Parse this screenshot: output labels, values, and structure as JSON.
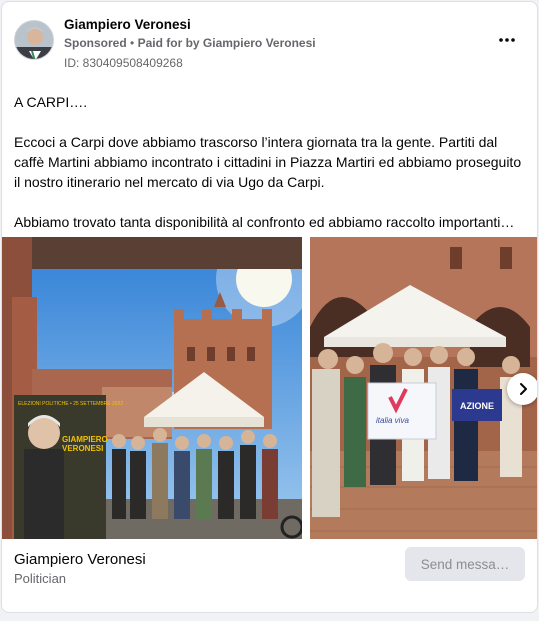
{
  "post": {
    "author": "Giampiero Veronesi",
    "sponsored_label": "Sponsored",
    "separator": "•",
    "paid_for_label": "Paid for by Giampiero Veronesi",
    "id_label": "ID: 830409508409268",
    "paragraphs": [
      "A CARPI….",
      "Eccoci a Carpi dove abbiamo trascorso l’intera giornata tra la gente. Partiti dal caffè Martini abbiamo incontrato i cittadini in Piazza Martiri ed abbiamo proseguito il nostro itinerario nel mercato di via Ugo da Carpi.",
      "Abbiamo trovato tanta disponibilità al confronto ed abbiamo raccolto importanti…"
    ]
  },
  "images": {
    "poster_header": "ELEZIONI POLITICHE • 25 SETTEMBRE 2022",
    "poster_name_1": "GIAMPIERO",
    "poster_name_2": "VERONESI",
    "flag_italia_viva": "italia viva",
    "flag_azione": "AZIONE"
  },
  "footer": {
    "page_name": "Giampiero Veronesi",
    "category": "Politician",
    "send_button": "Send messa…"
  },
  "colors": {
    "accent": "#1877f2",
    "muted": "#65676b"
  }
}
